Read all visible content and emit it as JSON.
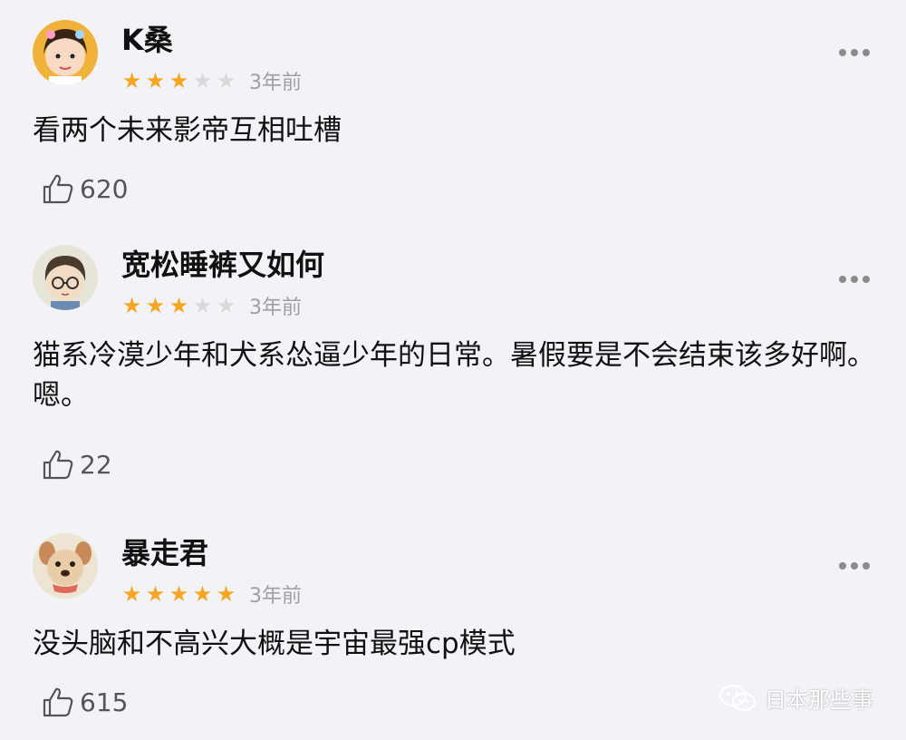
{
  "colors": {
    "background": "#f3f2f7",
    "star_on": "#f5a623",
    "star_off": "#d9d9d9",
    "meta_text": "#a0a0a0"
  },
  "comments": [
    {
      "username": "K桑",
      "rating": 3,
      "max_rating": 5,
      "time": "3年前",
      "text": "看两个未来影帝互相吐槽",
      "likes": "620",
      "avatar_icon": "girl-avatar-icon"
    },
    {
      "username": "宽松睡裤又如何",
      "rating": 3,
      "max_rating": 5,
      "time": "3年前",
      "text": "猫系冷漠少年和犬系怂逼少年的日常。暑假要是不会结束该多好啊。嗯。",
      "likes": "22",
      "avatar_icon": "anime-boy-avatar-icon"
    },
    {
      "username": "暴走君",
      "rating": 5,
      "max_rating": 5,
      "time": "3年前",
      "text": "没头脑和不高兴大概是宇宙最强cp模式",
      "likes": "615",
      "avatar_icon": "puppy-avatar-icon"
    }
  ],
  "watermark": {
    "text": "日本那些事",
    "icon": "wechat-icon"
  }
}
